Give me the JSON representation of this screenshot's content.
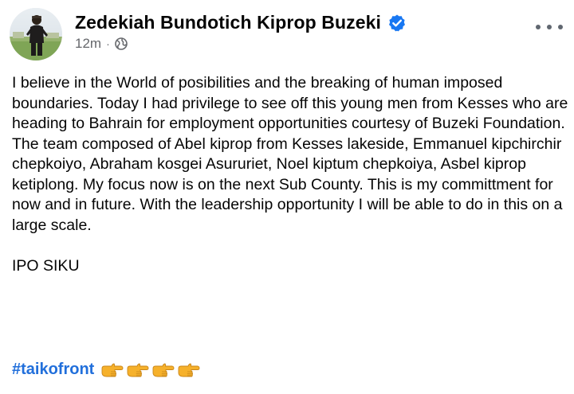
{
  "post": {
    "author_name": "Zedekiah Bundotich Kiprop Buzeki",
    "verified_icon": "verified-badge-icon",
    "timestamp": "12m",
    "separator": "·",
    "audience_icon": "globe-icon",
    "more_icon": "more-options-icon",
    "paragraph_1": "I believe in the World of posibilities and the breaking of human imposed boundaries. Today I had privilege to see off this young men from Kesses who are heading to Bahrain for employment opportunities courtesy of Buzeki Foundation.",
    "paragraph_2": "The team composed of Abel kiprop from Kesses  lakeside, Emmanuel kipchirchir chepkoiyo, Abraham kosgei Asururiet, Noel kiptum chepkoiya, Asbel kiprop ketiplong. My focus now is on the next Sub County. This is my committment for now and in future. With the leadership opportunity I will be able to do in this on a large scale.",
    "paragraph_3": "IPO SIKU",
    "hashtag": "#taikofront",
    "emoji_icons": [
      "pointing-right-hand-icon",
      "pointing-right-hand-icon",
      "pointing-right-hand-icon",
      "pointing-right-hand-icon"
    ],
    "colors": {
      "link": "#216fdb",
      "verified": "#1877f2",
      "meta": "#65676b"
    }
  }
}
